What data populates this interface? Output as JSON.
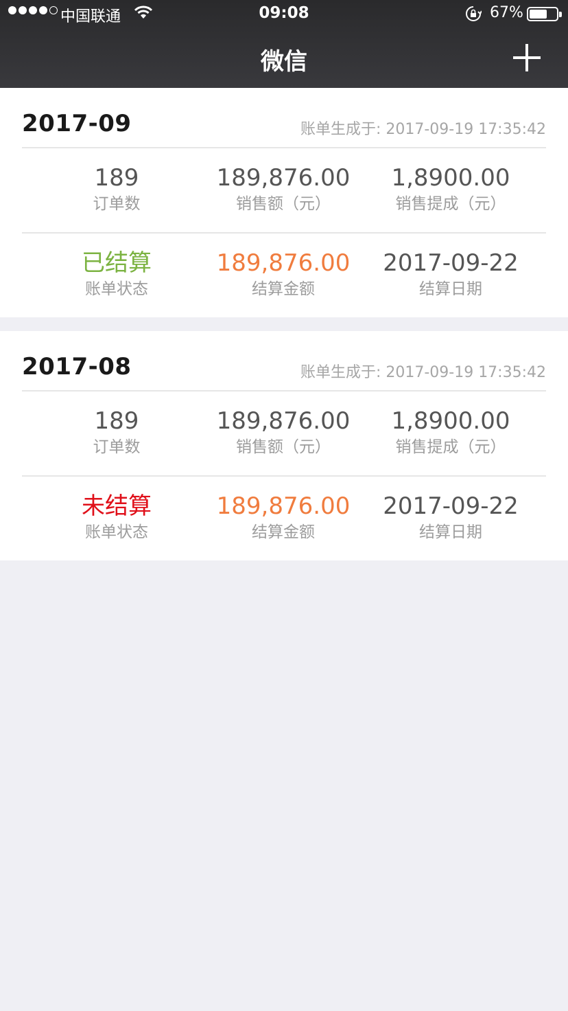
{
  "status_bar": {
    "carrier": "中国联通",
    "time": "09:08",
    "battery_percent": "67%",
    "battery_level": 0.67
  },
  "nav": {
    "title": "微信",
    "add_icon": "plus-icon"
  },
  "bills": [
    {
      "month": "2017-09",
      "generated": "账单生成于:  2017-09-19 17:35:42",
      "orders": "189",
      "orders_label": "订单数",
      "sales": "189,876.00",
      "sales_label": "销售额（元）",
      "commission": "1,8900.00",
      "commission_label": "销售提成（元）",
      "status": "已结算",
      "status_color": "#7cb342",
      "status_label": "账单状态",
      "settle_amount": "189,876.00",
      "settle_amount_color": "#f07c3e",
      "settle_amount_label": "结算金额",
      "settle_date": "2017-09-22",
      "settle_date_label": "结算日期"
    },
    {
      "month": "2017-08",
      "generated": "账单生成于:  2017-09-19 17:35:42",
      "orders": "189",
      "orders_label": "订单数",
      "sales": "189,876.00",
      "sales_label": "销售额（元）",
      "commission": "1,8900.00",
      "commission_label": "销售提成（元）",
      "status": "未结算",
      "status_color": "#e0101a",
      "status_label": "账单状态",
      "settle_amount": "189,876.00",
      "settle_amount_color": "#f07c3e",
      "settle_amount_label": "结算金额",
      "settle_date": "2017-09-22",
      "settle_date_label": "结算日期"
    }
  ]
}
